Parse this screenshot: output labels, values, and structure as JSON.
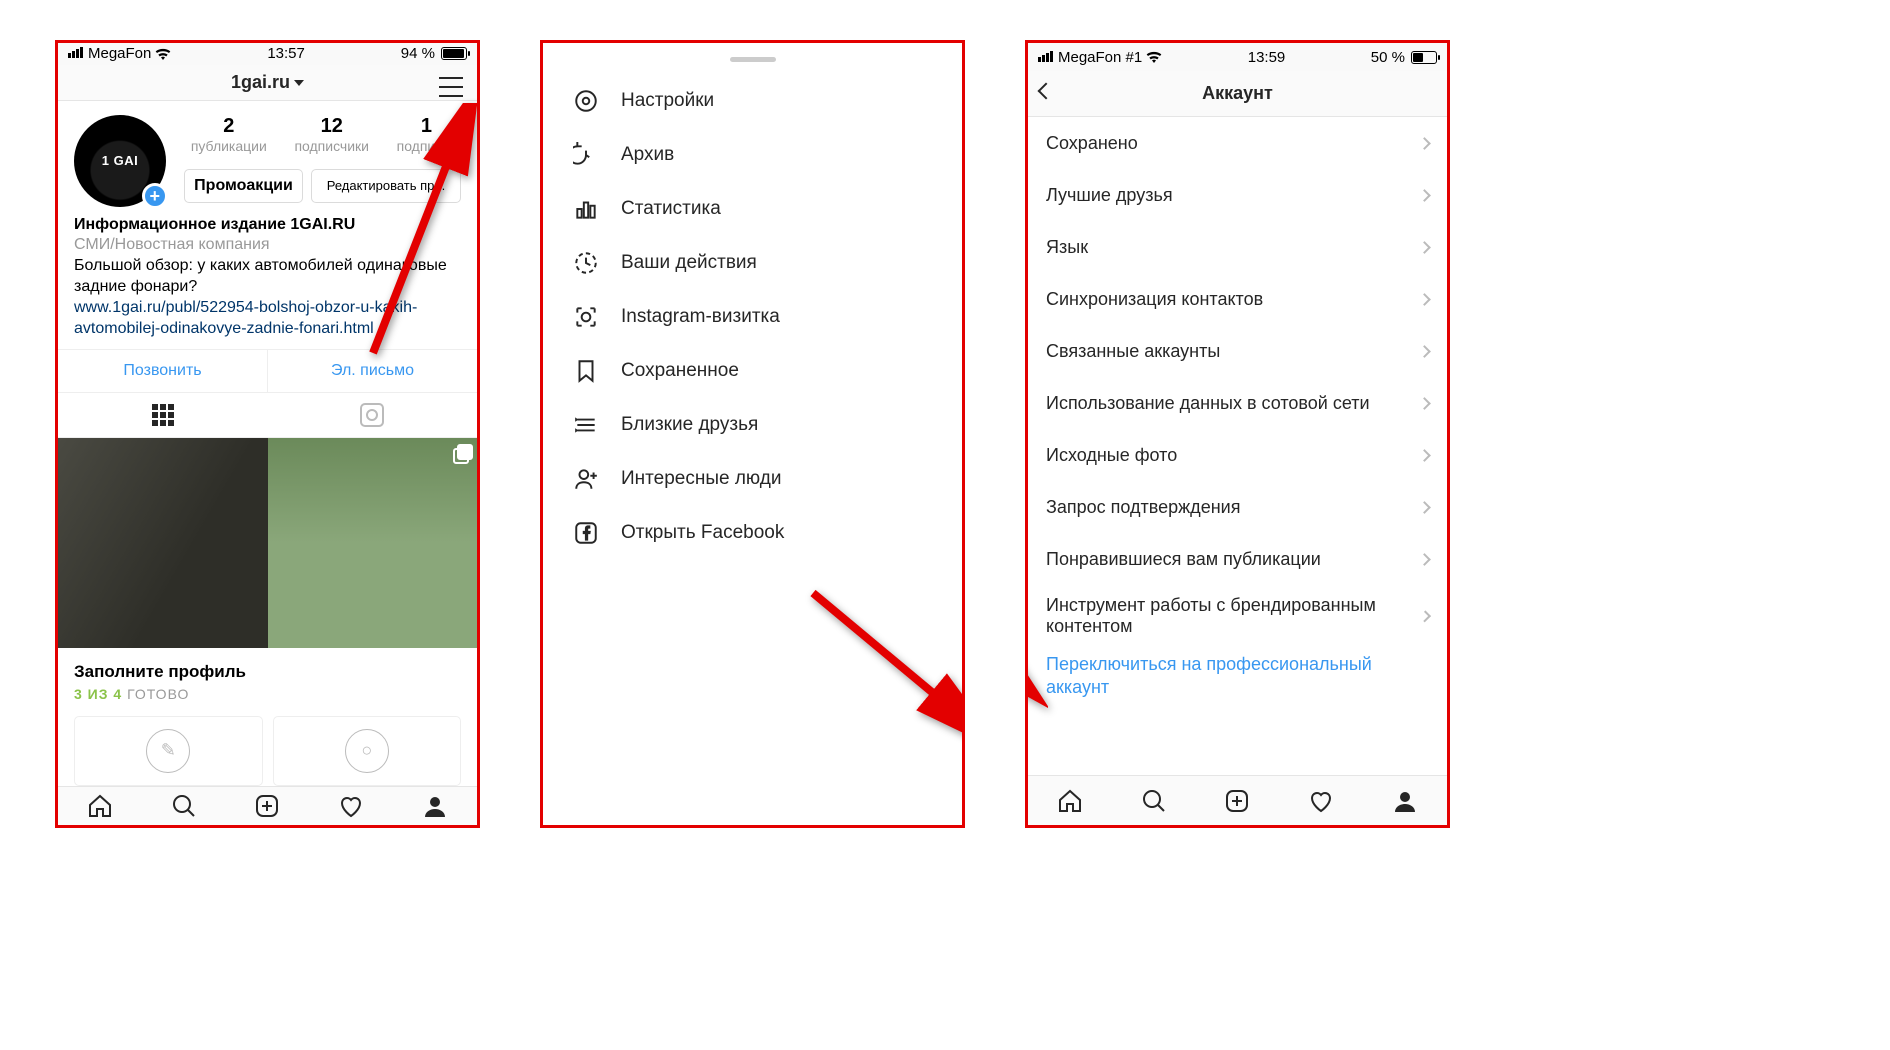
{
  "screen1": {
    "status": {
      "carrier": "MegaFon",
      "time": "13:57",
      "battery_text": "94 %",
      "battery_pct": 94
    },
    "header": {
      "username": "1gai.ru"
    },
    "avatar_text": "1 GAI",
    "stats": {
      "posts_num": "2",
      "posts_lbl": "публикации",
      "followers_num": "12",
      "followers_lbl": "подписчики",
      "following_num": "1",
      "following_lbl": "подписки"
    },
    "buttons": {
      "promo": "Промоакции",
      "edit": "Редактировать пр..."
    },
    "bio": {
      "name": "Информационное издание 1GAI.RU",
      "category": "СМИ/Новостная компания",
      "text": "Большой обзор: у каких автомобилей одинаковые задние фонари?",
      "link": "www.1gai.ru/publ/522954-bolshoj-obzor-u-kakih-avtomobilej-odinakovye-zadnie-fonari.html"
    },
    "contact": {
      "call": "Позвонить",
      "email": "Эл. письмо"
    },
    "complete": {
      "title": "Заполните профиль",
      "done": "3 ИЗ 4",
      "ready": " ГОТОВО"
    }
  },
  "screen2": {
    "menu": [
      {
        "icon": "gear",
        "label": "Настройки"
      },
      {
        "icon": "archive",
        "label": "Архив"
      },
      {
        "icon": "stats",
        "label": "Статистика"
      },
      {
        "icon": "activity",
        "label": "Ваши действия"
      },
      {
        "icon": "nametag",
        "label": "Instagram-визитка"
      },
      {
        "icon": "bookmark",
        "label": "Сохраненное"
      },
      {
        "icon": "closefriends",
        "label": "Близкие друзья"
      },
      {
        "icon": "discover",
        "label": "Интересные люди"
      },
      {
        "icon": "facebook",
        "label": "Открыть Facebook"
      }
    ]
  },
  "screen3": {
    "status": {
      "carrier": "MegaFon #1",
      "time": "13:59",
      "battery_text": "50 %",
      "battery_pct": 50
    },
    "header": {
      "title": "Аккаунт"
    },
    "items": [
      "Сохранено",
      "Лучшие друзья",
      "Язык",
      "Синхронизация контактов",
      "Связанные аккаунты",
      "Использование данных в сотовой сети",
      "Исходные фото",
      "Запрос подтверждения",
      "Понравившиеся вам публикации",
      "Инструмент работы с брендированным контентом"
    ],
    "link": "Переключиться на профессиональный аккаунт"
  }
}
